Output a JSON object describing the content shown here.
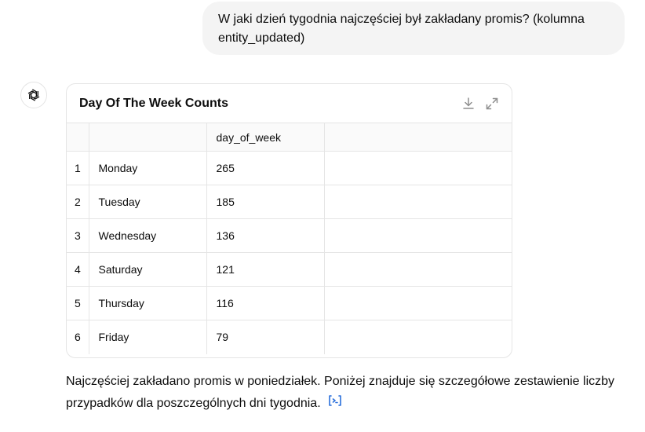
{
  "user_message": "W jaki dzień tygodnia najczęściej był zakładany promis? (kolumna entity_updated)",
  "table_card": {
    "title": "Day Of The Week Counts",
    "icons": [
      "download-icon",
      "expand-icon"
    ],
    "columns": [
      "",
      "",
      "day_of_week",
      ""
    ],
    "rows": [
      {
        "index": "1",
        "day": "Monday",
        "count": "265"
      },
      {
        "index": "2",
        "day": "Tuesday",
        "count": "185"
      },
      {
        "index": "3",
        "day": "Wednesday",
        "count": "136"
      },
      {
        "index": "4",
        "day": "Saturday",
        "count": "121"
      },
      {
        "index": "5",
        "day": "Thursday",
        "count": "116"
      },
      {
        "index": "6",
        "day": "Friday",
        "count": "79"
      }
    ]
  },
  "assistant_answer": "Najczęściej zakładano promis w poniedziałek. Poniżej znajduje się szczegółowe zestawienie liczby przypadków dla poszczególnych dni tygodnia.",
  "colors": {
    "accent": "#2a6fdb",
    "user_bubble": "#f4f4f4",
    "border": "#e5e5e5"
  }
}
